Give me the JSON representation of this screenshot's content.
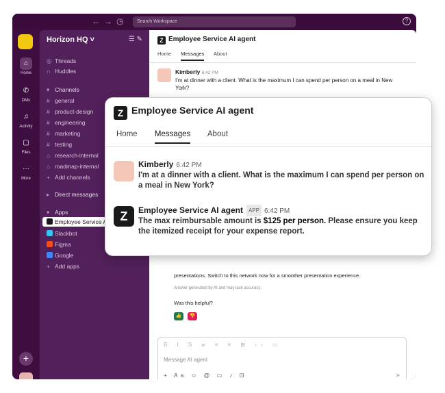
{
  "topbar": {
    "back_icon": "←",
    "forward_icon": "→",
    "history_icon": "◷",
    "search_placeholder": "Search Workspace",
    "help_icon": "?"
  },
  "rail": {
    "items": [
      {
        "label": "Home",
        "icon": "⌂"
      },
      {
        "label": "DMs",
        "icon": "✆"
      },
      {
        "label": "Activity",
        "icon": "♫"
      },
      {
        "label": "Files",
        "icon": "▢"
      },
      {
        "label": "More",
        "icon": "···"
      }
    ],
    "add_icon": "+"
  },
  "sidebar": {
    "workspace_name": "Horizon HQ",
    "threads": "Threads",
    "huddles": "Huddles",
    "channels_header": "Channels",
    "channels": [
      "general",
      "product-design",
      "engineering",
      "marketing",
      "testing"
    ],
    "locked_channels": [
      "research-internal",
      "roadmap-internal"
    ],
    "add_channels": "Add channels",
    "dm_header": "Direct messages",
    "apps_header": "Apps",
    "apps": [
      {
        "label": "Employee Service A",
        "color": "#17191b"
      },
      {
        "label": "Slackbot",
        "color": "#36c5f0"
      },
      {
        "label": "Figma",
        "color": "#f24e1e"
      },
      {
        "label": "Google",
        "color": "#4285f4"
      }
    ],
    "add_apps": "Add apps"
  },
  "main": {
    "title": "Employee Service AI agent",
    "tabs": [
      "Home",
      "Messages",
      "About"
    ],
    "msg_name": "Kimberly",
    "msg_time": "6:42 PM",
    "msg_text": "I'm at dinner with a client. What is the maximum I can spend per person on a meal in New York?",
    "lower_text": "presentations. Switch to this network now for a smoother presentation experience.",
    "disclaimer": "Answer generated by AI and may lack accuracy.",
    "helpful_question": "Was this helpful?",
    "thumbs_up": "👍",
    "thumbs_down": "👎",
    "composer_placeholder": "Message AI agent",
    "format_bar": "B I S ⌀ ≡ ≡ ⊞ ‹› ▭",
    "tools_bar": "+ Aa ☺ @ ▭ ♪ ⊡",
    "send_icon": "➤"
  },
  "card": {
    "title": "Employee Service AI agent",
    "tabs": [
      "Home",
      "Messages",
      "About"
    ],
    "user_name": "Kimberly",
    "user_time": "6:42 PM",
    "user_text": "I'm at a dinner with a client. What is the maximum I can spend per person on a meal in New York?",
    "agent_name": "Employee Service AI agent",
    "agent_badge": "APP",
    "agent_time": "6:42 PM",
    "agent_text_pre": "The max reimbursable amount is ",
    "agent_text_bold": "$125 per person.",
    "agent_text_post": " Please ensure you keep the itemized receipt for your expense report."
  }
}
